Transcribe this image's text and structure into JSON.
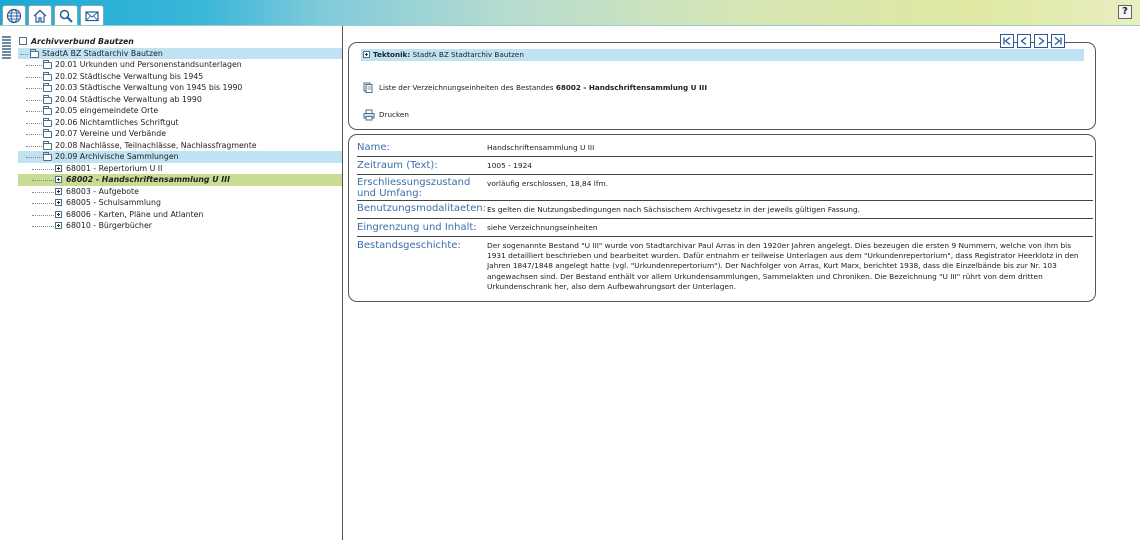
{
  "toolbar": {
    "tabs": [
      {
        "icon": "globe-icon"
      },
      {
        "icon": "home-icon"
      },
      {
        "icon": "search-icon"
      },
      {
        "icon": "mail-icon"
      }
    ],
    "help_label": "?"
  },
  "tree": {
    "root": "Archivverbund Bautzen",
    "archive": "StadtA BZ Stadtarchiv Bautzen",
    "groups": [
      "20.01 Urkunden und Personenstandsunterlagen",
      "20.02 Städtische Verwaltung bis 1945",
      "20.03 Städtische Verwaltung von 1945 bis 1990",
      "20.04 Städtische Verwaltung ab 1990",
      "20.05 eingemeindete Orte",
      "20.06 Nichtamtliches Schriftgut",
      "20.07 Vereine und Verbände",
      "20.08 Nachlässe, Teilnachlässe, Nachlassfragmente",
      "20.09 Archivische Sammlungen"
    ],
    "collections": [
      "68001 - Repertorium U II",
      "68002 - Handschriftensammlung U III",
      "68003 - Aufgebote",
      "68005 - Schulsammlung",
      "68006 - Karten, Pläne und Atlanten",
      "68010 - Bürgerbücher"
    ]
  },
  "header": {
    "tektonik_label": "Tektonik:",
    "tektonik_value": "StadtA BZ Stadtarchiv Bautzen",
    "liste_text": "Liste der Verzeichnungseinheiten des Bestandes",
    "liste_bold": "68002 - Handschriftensammlung U III",
    "drucken": "Drucken"
  },
  "details": [
    {
      "key": "Name:",
      "value": "Handschriftensammlung U III"
    },
    {
      "key": "Zeitraum (Text):",
      "value": "1005 - 1924"
    },
    {
      "key": "Erschliessungszustand und Umfang:",
      "value": "vorläufig erschlossen, 18,84 lfm."
    },
    {
      "key": "Benutzungsmodalitaeten:",
      "value": "Es gelten die Nutzungsbedingungen nach Sächsischem Archivgesetz in der jeweils gültigen Fassung."
    },
    {
      "key": "Eingrenzung und Inhalt:",
      "value": "siehe Verzeichnungseinheiten"
    },
    {
      "key": "Bestandsgeschichte:",
      "value": "Der sogenannte Bestand \"U III\" wurde von Stadtarchivar Paul Arras in den 1920er Jahren angelegt. Dies bezeugen die ersten 9 Nummern, welche von ihm bis 1931 detailliert beschrieben und bearbeitet wurden. Dafür entnahm er teilweise Unterlagen aus dem \"Urkundenrepertorium\", dass Registrator Heerklotz in den Jahren 1847/1848 angelegt hatte (vgl. \"Urkundenrepertorium\"). Der Nachfolger von Arras, Kurt Marx, berichtet 1938, dass die Einzelbände bis zur Nr. 103 angewachsen sind. Der Bestand enthält vor allem Urkundensammlungen, Sammelakten und Chroniken. Die Bezeichnung \"U III\" rührt von dem dritten Urkundenschrank her, also dem Aufbewahrungsort der Unterlagen."
    }
  ]
}
